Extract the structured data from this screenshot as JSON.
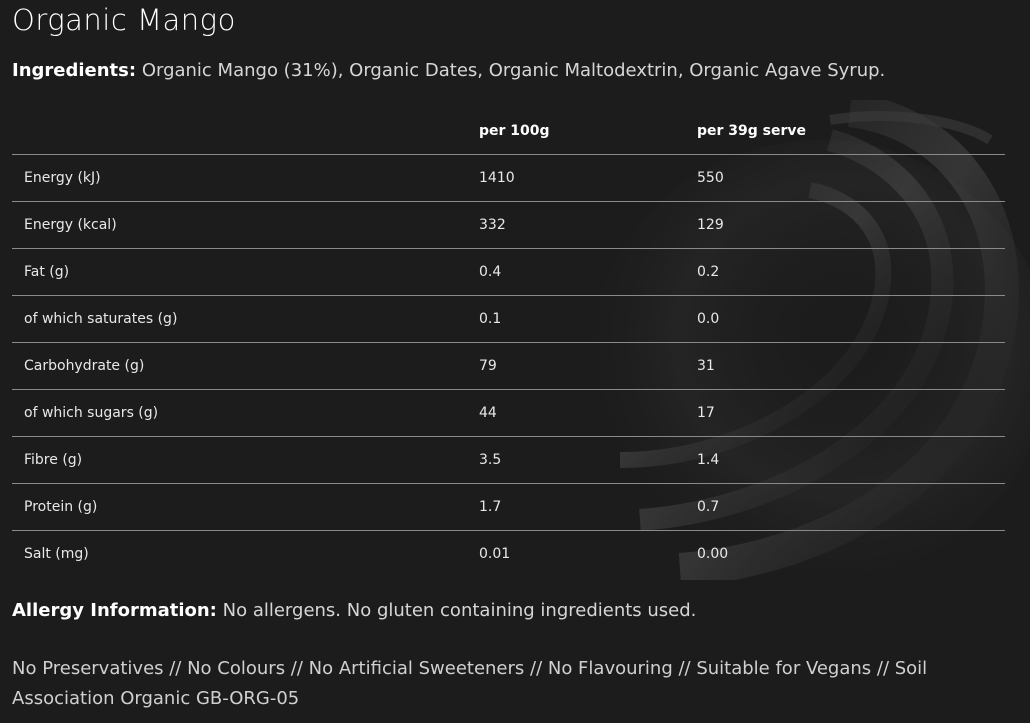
{
  "title": "Organic Mango",
  "ingredients": {
    "label": "Ingredients:",
    "text": "Organic Mango (31%), Organic Dates, Organic Maltodextrin, Organic Agave Syrup."
  },
  "nutrition": {
    "headers": [
      "",
      "per 100g",
      "per 39g serve"
    ],
    "rows": [
      {
        "name": "Energy (kJ)",
        "per100": "1410",
        "serve": "550"
      },
      {
        "name": "Energy (kcal)",
        "per100": "332",
        "serve": "129"
      },
      {
        "name": "Fat (g)",
        "per100": "0.4",
        "serve": "0.2"
      },
      {
        "name": "of which saturates (g)",
        "per100": "0.1",
        "serve": "0.0"
      },
      {
        "name": "Carbohydrate (g)",
        "per100": "79",
        "serve": "31"
      },
      {
        "name": "of which sugars (g)",
        "per100": "44",
        "serve": "17"
      },
      {
        "name": "Fibre (g)",
        "per100": "3.5",
        "serve": "1.4"
      },
      {
        "name": "Protein (g)",
        "per100": "1.7",
        "serve": "0.7"
      },
      {
        "name": "Salt (mg)",
        "per100": "0.01",
        "serve": "0.00"
      }
    ]
  },
  "allergy": {
    "label": "Allergy Information:",
    "text": "No allergens. No gluten containing ingredients used."
  },
  "claims": "No Preservatives // No Colours // No Artificial Sweeteners // No Flavouring // Suitable for Vegans // Soil Association Organic GB-ORG-05",
  "colors": {
    "background": "#1c1c1c",
    "text": "#ffffff",
    "divider": "#8a8a8a"
  }
}
